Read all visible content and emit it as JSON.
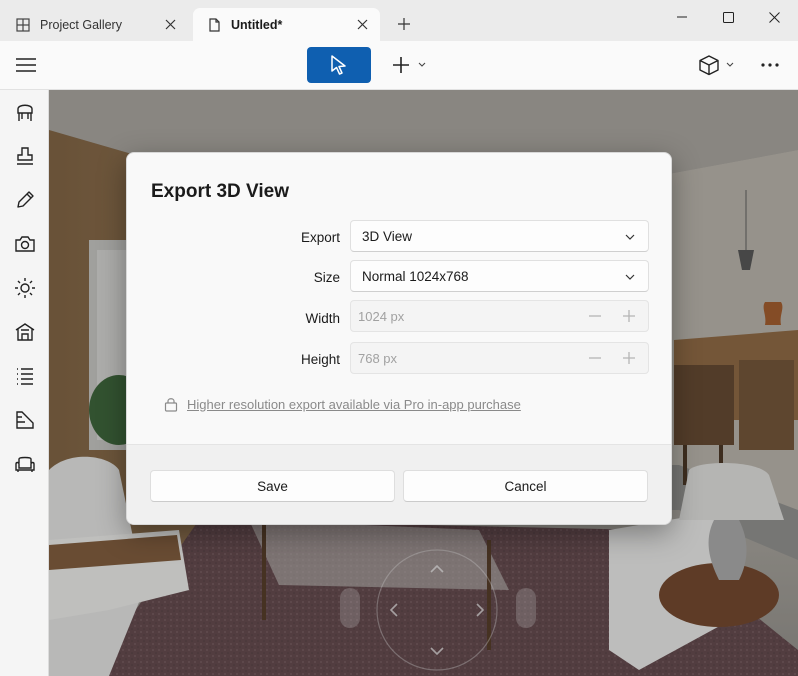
{
  "tabs": [
    {
      "label": "Project Gallery",
      "icon": "gallery-icon",
      "active": false
    },
    {
      "label": "Untitled*",
      "icon": "document-icon",
      "active": true
    }
  ],
  "window": {
    "minimize": "minimize-icon",
    "maximize": "maximize-icon",
    "close": "close-icon"
  },
  "toolbar": {
    "select_tool": "pointer-icon",
    "add": "plus-icon",
    "view_mode": "cube-icon",
    "more": "more-icon"
  },
  "sidebar": {
    "items": [
      "furniture-icon",
      "stamp-icon",
      "pencil-icon",
      "camera-icon",
      "sun-icon",
      "house-icon",
      "list-icon",
      "materials-icon",
      "sofa-icon"
    ]
  },
  "dialog": {
    "title": "Export 3D View",
    "export_label": "Export",
    "export_value": "3D View",
    "size_label": "Size",
    "size_value": "Normal 1024x768",
    "width_label": "Width",
    "width_value": "1024 px",
    "height_label": "Height",
    "height_value": "768 px",
    "pro_note": "Higher resolution export available via Pro in-app purchase",
    "save_label": "Save",
    "cancel_label": "Cancel"
  },
  "colors": {
    "accent": "#0f5fb0",
    "dialog_bg": "#f9f9f9"
  }
}
